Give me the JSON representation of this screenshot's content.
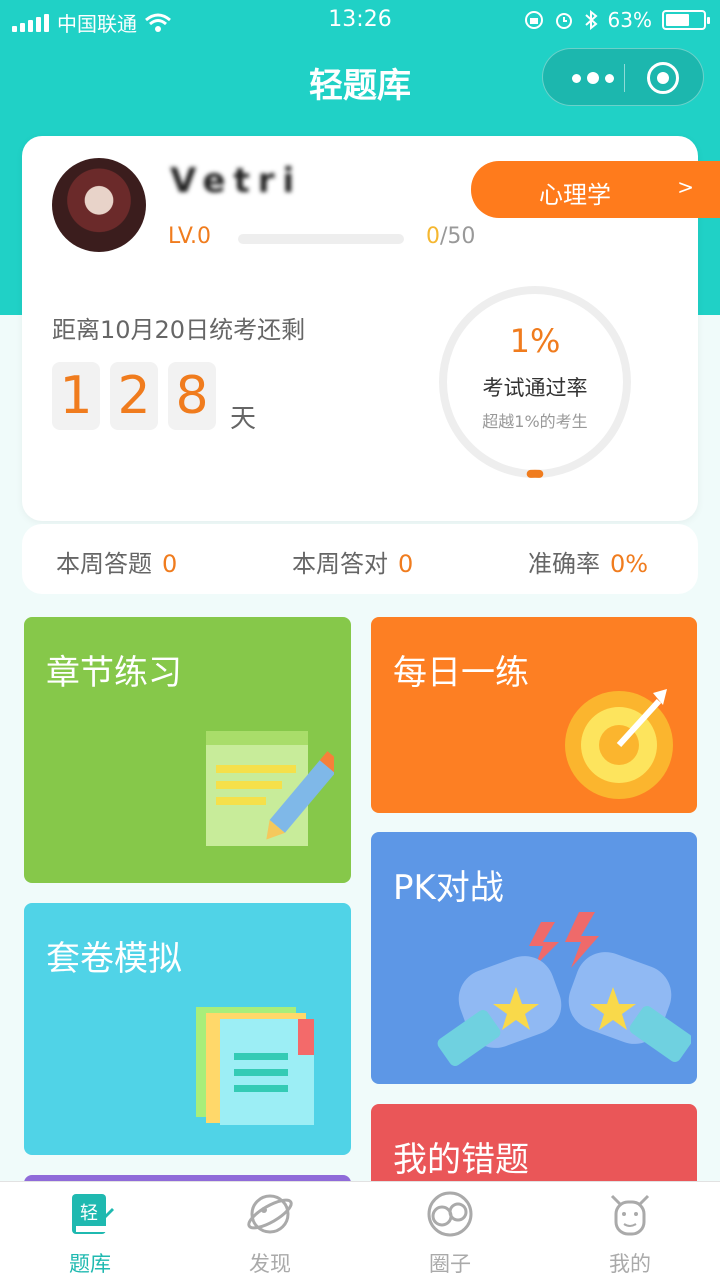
{
  "status_bar": {
    "carrier": "中国联通",
    "time": "13:26",
    "battery": "63%",
    "battery_level": 0.63
  },
  "nav": {
    "title": "轻题库"
  },
  "profile": {
    "username": "Vetri",
    "level": "LV.0",
    "xp_current": "0",
    "xp_total": "/50",
    "xp_progress": 0,
    "subject": "心理学",
    "subject_arrow": ">"
  },
  "countdown": {
    "label": "距离10月20日统考还剩",
    "digits": [
      "1",
      "2",
      "8"
    ],
    "unit": "天"
  },
  "pass_rate": {
    "percent": "1%",
    "label": "考试通过率",
    "sub": "超越1%的考生",
    "value": 0.01
  },
  "weekly": {
    "answered_label": "本周答题",
    "answered_value": "0",
    "correct_label": "本周答对",
    "correct_value": "0",
    "accuracy_label": "准确率",
    "accuracy_value": "0%"
  },
  "tiles": {
    "chapter": "章节练习",
    "daily": "每日一练",
    "paper": "套卷模拟",
    "pk": "PK对战",
    "wrong": "我的错题"
  },
  "tabs": [
    {
      "label": "题库",
      "icon": "book-icon",
      "active": true
    },
    {
      "label": "发现",
      "icon": "planet-icon",
      "active": false
    },
    {
      "label": "圈子",
      "icon": "circles-icon",
      "active": false
    },
    {
      "label": "我的",
      "icon": "cow-face-icon",
      "active": false
    }
  ],
  "colors": {
    "primary_teal": "#20d1c6",
    "accent_orange": "#f07c1e",
    "chapter_green": "#86c84a",
    "daily_orange": "#fd7f23",
    "paper_cyan": "#50d3e7",
    "pk_blue": "#5d97e6",
    "wrong_red": "#ea5658"
  }
}
